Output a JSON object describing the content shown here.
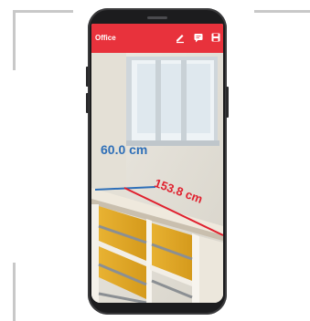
{
  "app": {
    "title": "Office",
    "bar_color": "#e8323c",
    "toolbar_icons": [
      "edit-icon",
      "note-icon",
      "save-icon"
    ]
  },
  "measurements": {
    "width_label": "60.0 cm",
    "width_color": "#2e6fb8",
    "length_label": "153.8 cm",
    "length_color": "#e0202e"
  }
}
